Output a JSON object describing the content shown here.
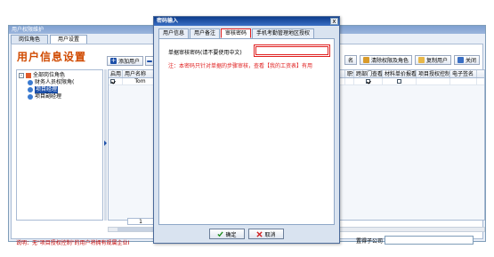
{
  "main": {
    "window_title": "用户权限维护",
    "tabs": [
      {
        "label": "岗位角色"
      },
      {
        "label": "用户设置"
      }
    ],
    "page_title": "用户信息设置",
    "toolbar_left": [
      {
        "label": "添加用户"
      }
    ],
    "toolbar_right": [
      {
        "label": "名"
      },
      {
        "label": "清除权限及角色"
      },
      {
        "label": "复制用户"
      },
      {
        "label": "关闭"
      }
    ],
    "tree": {
      "root": "全部岗位角色",
      "children": [
        "财务人员权限角(",
        "项目经理",
        "项目副经理"
      ],
      "selected_index": 1
    },
    "grid": {
      "headers_left": [
        "启用",
        "用户名称"
      ],
      "headers_right": [
        "职位",
        "跨部门查看",
        "材料单价报看",
        "项目授权控制",
        "电子签名"
      ],
      "row_left": {
        "enabled": true,
        "name": "Tom"
      },
      "row_right": {
        "cross_dept": true,
        "material_price": false
      }
    },
    "pager": "1",
    "note": "说明：无\"项目授权控制\"的用户将拥有规属企业I",
    "company_label": "置得子公司"
  },
  "dialog": {
    "title": "密码输入",
    "close_glyph": "x",
    "tabs": [
      {
        "label": "用户信息"
      },
      {
        "label": "用户备注"
      },
      {
        "label": "审核密码"
      },
      {
        "label": "手机考勤管理地区授权"
      }
    ],
    "active_tab": 2,
    "field_label": "单据审核密码(请不要使用中文)",
    "field_value": "",
    "hint": "注：本密码只针对单据的步骤审核，查看【我的工资表】有用",
    "ok_label": "确定",
    "cancel_label": "取消"
  },
  "colors": {
    "accent_red": "#e02020",
    "title_orange": "#d04a00",
    "title_bar": "#0d3c8c"
  }
}
